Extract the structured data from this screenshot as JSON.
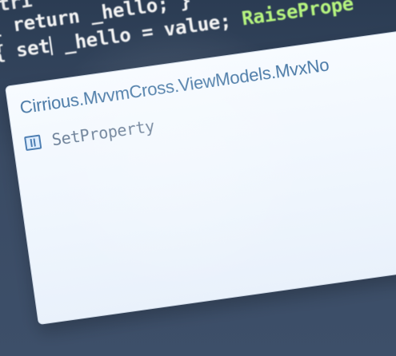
{
  "editor": {
    "line1": "stri",
    "line2": "{ return _hello; }",
    "line3_prefix": "{ set",
    "line3_rest": " _hello = value; ",
    "line3_call": "RaisePrope"
  },
  "completion_popup": {
    "header": "Cirrious.MvvmCross.ViewModels.MvxNo",
    "items": [
      {
        "label": "SetProperty",
        "icon": "method-icon"
      }
    ]
  },
  "colors": {
    "code_background": "#35465f",
    "popup_background": "#f4f9ff",
    "header_text": "#4a7aa7",
    "item_text": "#6b7f97",
    "code_green": "#b6f57f"
  }
}
